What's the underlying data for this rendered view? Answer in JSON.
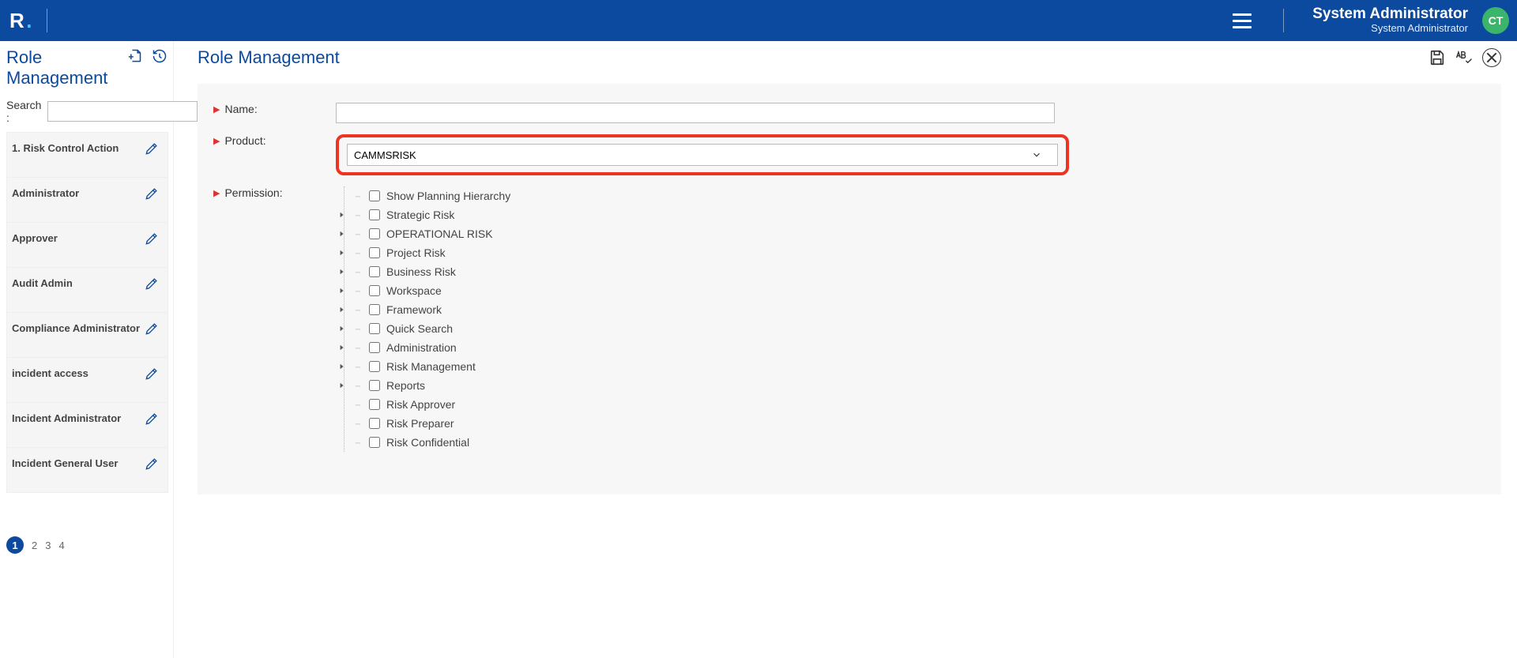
{
  "header": {
    "logo_letter": "R",
    "logo_dot": ".",
    "user_name": "System Administrator",
    "user_role": "System Administrator",
    "avatar_initials": "CT"
  },
  "sidebar": {
    "title": "Role Management",
    "search_label": "Search :",
    "search_value": "",
    "roles": [
      {
        "label": "1. Risk Control Action"
      },
      {
        "label": "Administrator"
      },
      {
        "label": "Approver"
      },
      {
        "label": "Audit Admin"
      },
      {
        "label": "Compliance Administrator"
      },
      {
        "label": "incident access"
      },
      {
        "label": "Incident Administrator"
      },
      {
        "label": "Incident General User"
      }
    ],
    "pager": {
      "current": "1",
      "others": [
        "2",
        "3",
        "4"
      ]
    }
  },
  "main": {
    "title": "Role Management",
    "form": {
      "name_label": "Name:",
      "name_value": "",
      "product_label": "Product:",
      "product_value": "CAMMSRISK",
      "permission_label": "Permission:"
    },
    "permissions": [
      {
        "label": "Show Planning Hierarchy",
        "expandable": false
      },
      {
        "label": "Strategic Risk",
        "expandable": true
      },
      {
        "label": "OPERATIONAL RISK",
        "expandable": true
      },
      {
        "label": "Project Risk",
        "expandable": true
      },
      {
        "label": "Business Risk",
        "expandable": true
      },
      {
        "label": "Workspace",
        "expandable": true
      },
      {
        "label": "Framework",
        "expandable": true
      },
      {
        "label": "Quick Search",
        "expandable": true
      },
      {
        "label": "Administration",
        "expandable": true
      },
      {
        "label": "Risk Management",
        "expandable": true
      },
      {
        "label": "Reports",
        "expandable": true
      },
      {
        "label": "Risk Approver",
        "expandable": false
      },
      {
        "label": "Risk Preparer",
        "expandable": false
      },
      {
        "label": "Risk Confidential",
        "expandable": false
      }
    ]
  }
}
